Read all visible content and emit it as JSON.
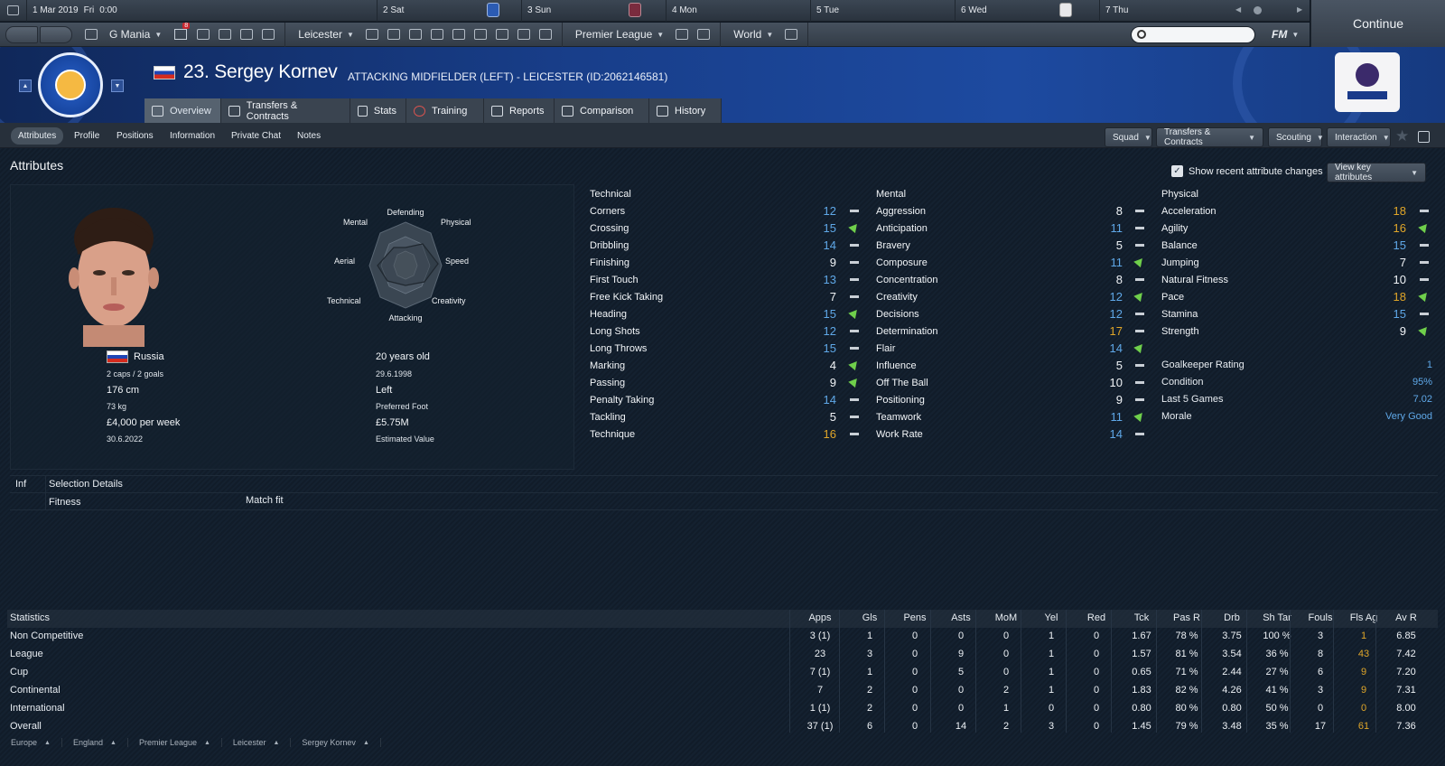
{
  "calendar": {
    "date": "1 Mar 2019",
    "day": "Fri",
    "time": "0:00",
    "days": [
      "2 Sat",
      "3 Sun",
      "4 Mon",
      "5 Tue",
      "6 Wed",
      "7 Thu"
    ]
  },
  "continue_label": "Continue",
  "nav": {
    "manager": "G Mania",
    "inbox_count": "8",
    "club": "Leicester",
    "competition": "Premier League",
    "world": "World",
    "fm": "FM"
  },
  "player": {
    "name": "23. Sergey Kornev",
    "subtitle": "ATTACKING MIDFIELDER (LEFT) - LEICESTER (ID:2062146581)"
  },
  "tabs": [
    "Overview",
    "Transfers & Contracts",
    "Stats",
    "Training",
    "Reports",
    "Comparison",
    "History"
  ],
  "subtabs": [
    "Attributes",
    "Profile",
    "Positions",
    "Information",
    "Private Chat",
    "Notes"
  ],
  "right_buttons": [
    "Squad",
    "Transfers & Contracts",
    "Scouting",
    "Interaction"
  ],
  "page_title": "Attributes",
  "show_recent": "Show recent attribute changes",
  "view_key": "View key attributes",
  "radar": {
    "labels": [
      "Defending",
      "Physical",
      "Speed",
      "Creativity",
      "Attacking",
      "Technical",
      "Aerial",
      "Mental"
    ]
  },
  "profile": {
    "nation": "Russia",
    "caps": "2 caps / 2 goals",
    "height": "176 cm",
    "weight": "73 kg",
    "wage": "£4,000 per week",
    "contract": "30.6.2022",
    "age": "20 years old",
    "dob": "29.6.1998",
    "foot": "Left",
    "foot_label": "Preferred Foot",
    "value": "£5.75M",
    "value_label": "Estimated Value"
  },
  "technical": {
    "title": "Technical",
    "items": [
      {
        "name": "Corners",
        "value": "12",
        "color": "blue",
        "trend": "eq"
      },
      {
        "name": "Crossing",
        "value": "15",
        "color": "blue",
        "trend": "up"
      },
      {
        "name": "Dribbling",
        "value": "14",
        "color": "blue",
        "trend": "eq"
      },
      {
        "name": "Finishing",
        "value": "9",
        "color": "white",
        "trend": "eq"
      },
      {
        "name": "First Touch",
        "value": "13",
        "color": "blue",
        "trend": "eq"
      },
      {
        "name": "Free Kick Taking",
        "value": "7",
        "color": "white",
        "trend": "eq"
      },
      {
        "name": "Heading",
        "value": "15",
        "color": "blue",
        "trend": "up"
      },
      {
        "name": "Long Shots",
        "value": "12",
        "color": "blue",
        "trend": "eq"
      },
      {
        "name": "Long Throws",
        "value": "15",
        "color": "blue",
        "trend": "eq"
      },
      {
        "name": "Marking",
        "value": "4",
        "color": "white",
        "trend": "up"
      },
      {
        "name": "Passing",
        "value": "9",
        "color": "white",
        "trend": "up"
      },
      {
        "name": "Penalty Taking",
        "value": "14",
        "color": "blue",
        "trend": "eq"
      },
      {
        "name": "Tackling",
        "value": "5",
        "color": "white",
        "trend": "eq"
      },
      {
        "name": "Technique",
        "value": "16",
        "color": "gold",
        "trend": "eq"
      }
    ]
  },
  "mental": {
    "title": "Mental",
    "items": [
      {
        "name": "Aggression",
        "value": "8",
        "color": "white",
        "trend": "eq"
      },
      {
        "name": "Anticipation",
        "value": "11",
        "color": "blue",
        "trend": "eq"
      },
      {
        "name": "Bravery",
        "value": "5",
        "color": "white",
        "trend": "eq"
      },
      {
        "name": "Composure",
        "value": "11",
        "color": "blue",
        "trend": "up"
      },
      {
        "name": "Concentration",
        "value": "8",
        "color": "white",
        "trend": "eq"
      },
      {
        "name": "Creativity",
        "value": "12",
        "color": "blue",
        "trend": "up"
      },
      {
        "name": "Decisions",
        "value": "12",
        "color": "blue",
        "trend": "eq"
      },
      {
        "name": "Determination",
        "value": "17",
        "color": "gold",
        "trend": "eq"
      },
      {
        "name": "Flair",
        "value": "14",
        "color": "blue",
        "trend": "up"
      },
      {
        "name": "Influence",
        "value": "5",
        "color": "white",
        "trend": "eq"
      },
      {
        "name": "Off The Ball",
        "value": "10",
        "color": "white",
        "trend": "eq"
      },
      {
        "name": "Positioning",
        "value": "9",
        "color": "white",
        "trend": "eq"
      },
      {
        "name": "Teamwork",
        "value": "11",
        "color": "blue",
        "trend": "up"
      },
      {
        "name": "Work Rate",
        "value": "14",
        "color": "blue",
        "trend": "eq"
      }
    ]
  },
  "physical": {
    "title": "Physical",
    "items": [
      {
        "name": "Acceleration",
        "value": "18",
        "color": "gold",
        "trend": "eq"
      },
      {
        "name": "Agility",
        "value": "16",
        "color": "gold",
        "trend": "up"
      },
      {
        "name": "Balance",
        "value": "15",
        "color": "blue",
        "trend": "eq"
      },
      {
        "name": "Jumping",
        "value": "7",
        "color": "white",
        "trend": "eq"
      },
      {
        "name": "Natural Fitness",
        "value": "10",
        "color": "white",
        "trend": "eq"
      },
      {
        "name": "Pace",
        "value": "18",
        "color": "gold",
        "trend": "up"
      },
      {
        "name": "Stamina",
        "value": "15",
        "color": "blue",
        "trend": "eq"
      },
      {
        "name": "Strength",
        "value": "9",
        "color": "white",
        "trend": "up"
      }
    ],
    "extra": [
      {
        "k": "Goalkeeper Rating",
        "v": "1"
      },
      {
        "k": "Condition",
        "v": "95%"
      },
      {
        "k": "Last 5 Games",
        "v": "7.02"
      },
      {
        "k": "Morale",
        "v": "Very Good"
      }
    ]
  },
  "selection": {
    "inf": "Inf",
    "title": "Selection Details",
    "fitness_label": "Fitness",
    "fitness_value": "Match fit"
  },
  "stats": {
    "title": "Statistics",
    "columns": [
      "Apps",
      "Gls",
      "Pens",
      "Asts",
      "MoM",
      "Yel",
      "Red",
      "Tck",
      "Pas R",
      "Drb",
      "Sh Tar",
      "Fouls",
      "Fls Ag",
      "Av R"
    ],
    "rows": [
      {
        "label": "Non Competitive",
        "cells": [
          "3 (1)",
          "1",
          "0",
          "0",
          "0",
          "1",
          "0",
          "1.67",
          "78 %",
          "3.75",
          "100 %",
          "3",
          "1",
          "6.85"
        ]
      },
      {
        "label": "League",
        "cells": [
          "23",
          "3",
          "0",
          "9",
          "0",
          "1",
          "0",
          "1.57",
          "81 %",
          "3.54",
          "36 %",
          "8",
          "43",
          "7.42"
        ]
      },
      {
        "label": "Cup",
        "cells": [
          "7 (1)",
          "1",
          "0",
          "5",
          "0",
          "1",
          "0",
          "0.65",
          "71 %",
          "2.44",
          "27 %",
          "6",
          "9",
          "7.20"
        ]
      },
      {
        "label": "Continental",
        "cells": [
          "7",
          "2",
          "0",
          "0",
          "2",
          "1",
          "0",
          "1.83",
          "82 %",
          "4.26",
          "41 %",
          "3",
          "9",
          "7.31"
        ]
      },
      {
        "label": "International",
        "cells": [
          "1 (1)",
          "2",
          "0",
          "0",
          "1",
          "0",
          "0",
          "0.80",
          "80 %",
          "0.80",
          "50 %",
          "0",
          "0",
          "8.00"
        ]
      },
      {
        "label": "Overall",
        "cells": [
          "37 (1)",
          "6",
          "0",
          "14",
          "2",
          "3",
          "0",
          "1.45",
          "79 %",
          "3.48",
          "35 %",
          "17",
          "61",
          "7.36"
        ]
      }
    ]
  },
  "breadcrumb": [
    "Europe",
    "England",
    "Premier League",
    "Leicester",
    "Sergey Kornev"
  ],
  "colors": {
    "blue": "#5fa8e8",
    "gold": "#e0a629",
    "up": "#6fcf4b"
  }
}
